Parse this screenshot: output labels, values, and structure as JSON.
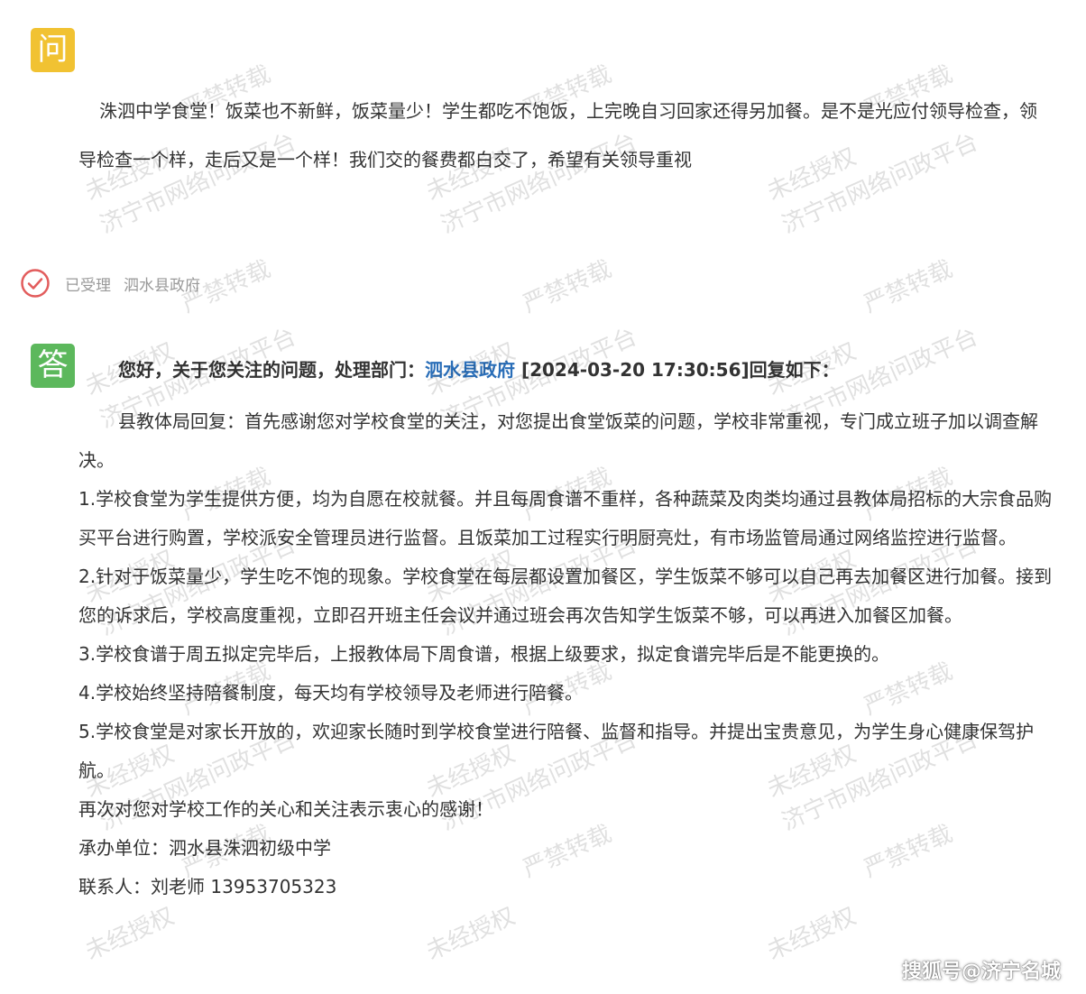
{
  "question": {
    "badge_label": "问",
    "text": "洙泗中学食堂！饭菜也不新鲜，饭菜量少！学生都吃不饱饭，上完晚自习回家还得另加餐。是不是光应付领导检查，领导检查一个样，走后又是一个样！我们交的餐费都白交了，希望有关领导重视"
  },
  "status": {
    "state": "已受理",
    "department": "泗水县政府"
  },
  "answer": {
    "badge_label": "答",
    "header_prefix": "您好，关于您关注的问题，处理部门：",
    "header_department": "泗水县政府",
    "header_suffix": " [2024-03-20 17:30:56]回复如下：",
    "paragraphs": [
      "县教体局回复：首先感谢您对学校食堂的关注，对您提出食堂饭菜的问题，学校非常重视，专门成立班子加以调查解决。",
      "1.学校食堂为学生提供方便，均为自愿在校就餐。并且每周食谱不重样，各种蔬菜及肉类均通过县教体局招标的大宗食品购买平台进行购置，学校派安全管理员进行监督。且饭菜加工过程实行明厨亮灶，有市场监管局通过网络监控进行监督。",
      "2.针对于饭菜量少，学生吃不饱的现象。学校食堂在每层都设置加餐区，学生饭菜不够可以自己再去加餐区进行加餐。接到您的诉求后，学校高度重视，立即召开班主任会议并通过班会再次告知学生饭菜不够，可以再进入加餐区加餐。",
      "3.学校食谱于周五拟定完毕后，上报教体局下周食谱，根据上级要求，拟定食谱完毕后是不能更换的。",
      "4.学校始终坚持陪餐制度，每天均有学校领导及老师进行陪餐。",
      "5.学校食堂是对家长开放的，欢迎家长随时到学校食堂进行陪餐、监督和指导。并提出宝贵意见，为学生身心健康保驾护航。",
      "再次对您对学校工作的关心和关注表示衷心的感谢！",
      "承办单位：泗水县洙泗初级中学",
      "联系人：刘老师 13953705323"
    ]
  },
  "watermark": {
    "line1": "严禁转载",
    "line2": "未经授权",
    "line3": "济宁市网络问政平台"
  },
  "footer": {
    "brand": "搜狐号@济宁名城"
  },
  "colors": {
    "question_badge": "#f1c232",
    "answer_badge": "#5cb85c",
    "status_icon": "#e25c5c",
    "department_link": "#2a6eb8"
  }
}
